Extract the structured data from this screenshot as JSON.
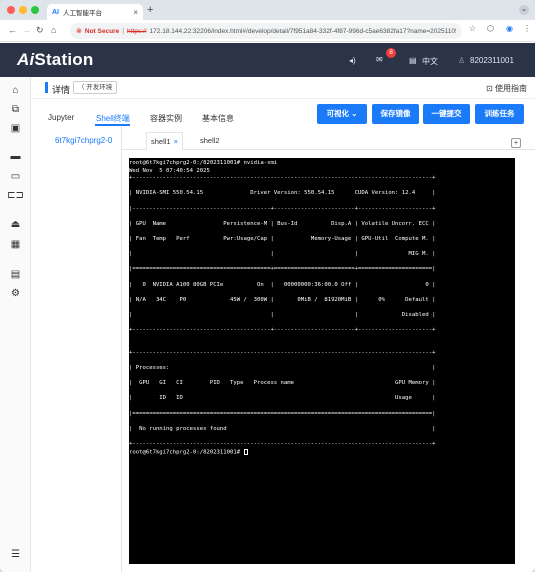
{
  "browser": {
    "tab_icon": "AI",
    "tab_title": "人工智能平台",
    "tab_close": "×",
    "new_tab": "+",
    "address": {
      "not_secure": "Not Secure",
      "scheme": "https://",
      "url": "172.18.144.22:32206/index.html#/develop/detail/7f951a84-332f-4f87-996d-c5ae6382fa17?name=2025110515345..."
    }
  },
  "header": {
    "logo_prefix": "Ai",
    "logo_suffix": "Station",
    "notification_count": "8",
    "language": "中文",
    "user": "8202311001"
  },
  "breadcrumb": {
    "title": "详情",
    "back_label": "〈 开发环境",
    "guide_label": "使用指南"
  },
  "main_tabs": [
    "Jupyter",
    "Shell终端",
    "容器实例",
    "基本信息"
  ],
  "actions": {
    "visualize": "可视化 ⌄",
    "save_image": "保存镜像",
    "submit": "一键提交",
    "train": "训练任务"
  },
  "pod_name": "6t7kgi7chprg2-0",
  "shell_tabs": [
    {
      "label": "shell1",
      "close": "×"
    },
    {
      "label": "shell2"
    }
  ],
  "terminal": {
    "lines": [
      "root@6t7kgi7chprg2-0:/8202311001# nvidia-smi",
      "Wed Nov  5 07:40:54 2025",
      "+-----------------------------------------------------------------------------------------+",
      "",
      "| NVIDIA-SMI 550.54.15              Driver Version: 550.54.15      CUDA Version: 12.4     |",
      "",
      "|-----------------------------------------+------------------------+----------------------+",
      "",
      "| GPU  Name                 Persistence-M | Bus-Id          Disp.A | Volatile Uncorr. ECC |",
      "",
      "| Fan  Temp   Perf          Pwr:Usage/Cap |           Memory-Usage | GPU-Util  Compute M. |",
      "",
      "|                                         |                        |               MIG M. |",
      "",
      "|=========================================+========================+======================|",
      "",
      "|   0  NVIDIA A100 80GB PCIe          On  |   00000000:36:00.0 Off |                    0 |",
      "",
      "| N/A   34C    P0             45W /  300W |       0MiB /  81920MiB |      0%      Default |",
      "",
      "|                                         |                        |             Disabled |",
      "",
      "+-----------------------------------------+------------------------+----------------------+",
      "",
      "",
      "+-----------------------------------------------------------------------------------------+",
      "",
      "| Processes:                                                                              |",
      "",
      "|  GPU   GI   CI        PID   Type   Process name                              GPU Memory |",
      "",
      "|        ID   ID                                                               Usage      |",
      "",
      "|=========================================================================================|",
      "",
      "|  No running processes found                                                             |",
      "",
      "+-----------------------------------------------------------------------------------------+",
      "root@6t7kgi7chprg2-0:/8202311001# "
    ]
  }
}
